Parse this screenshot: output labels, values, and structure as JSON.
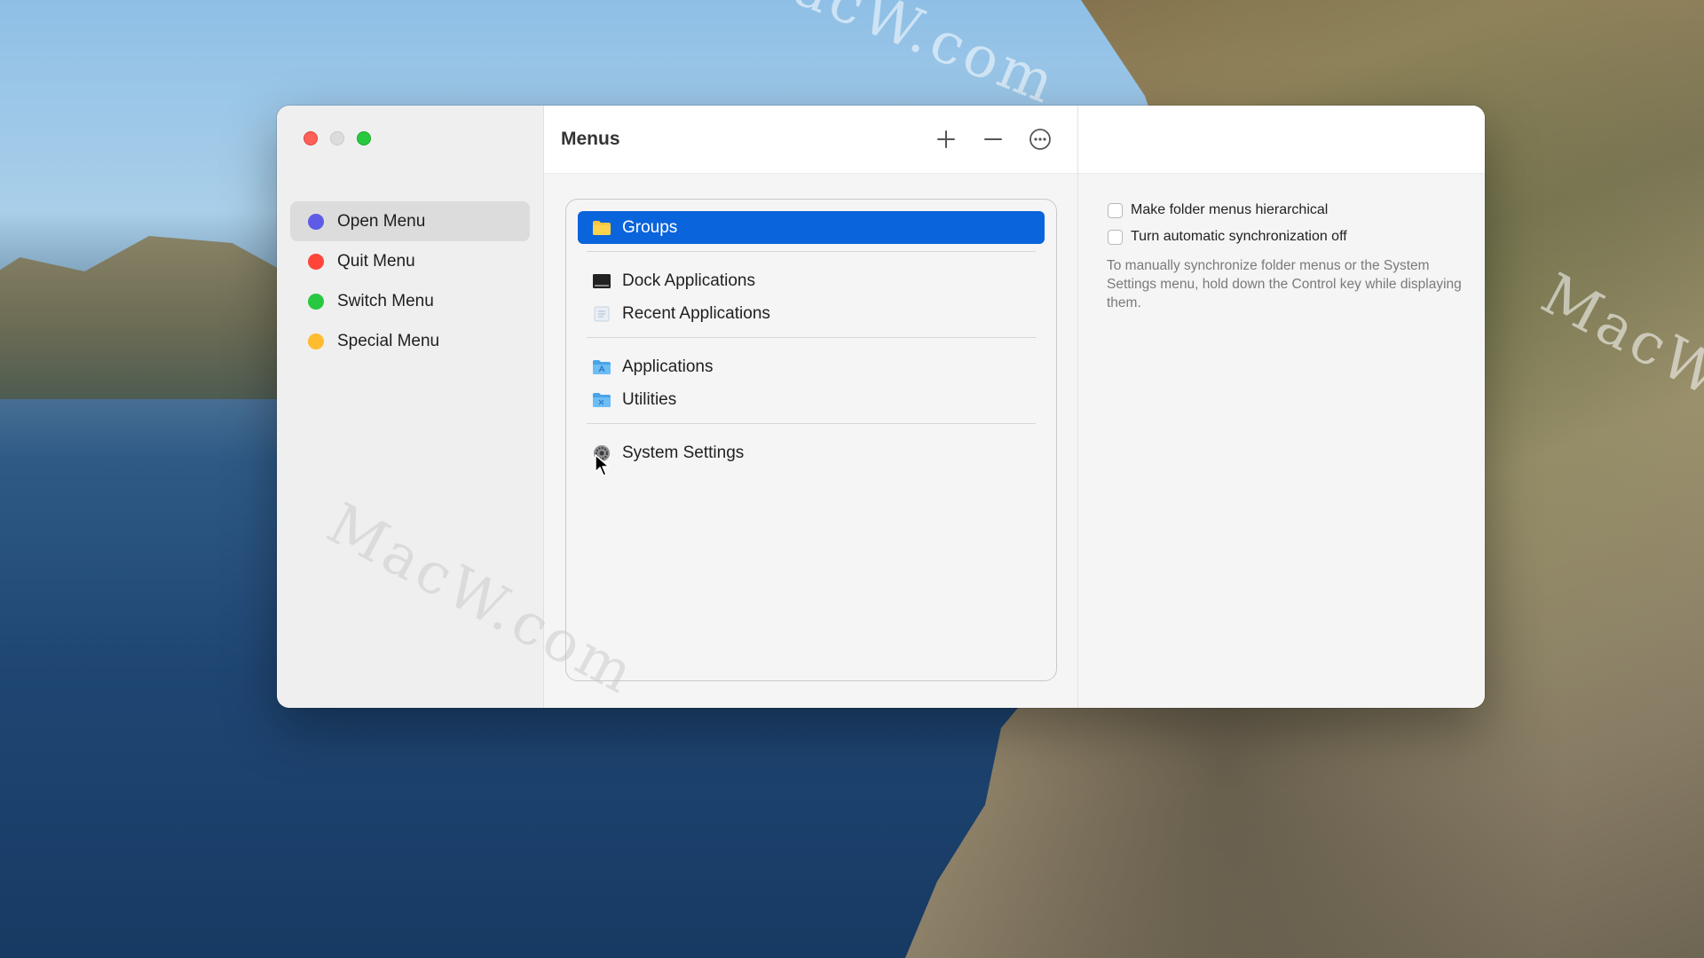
{
  "window": {
    "title": "Menus",
    "toolbar": {
      "add_icon": "plus-icon",
      "remove_icon": "minus-icon",
      "more_icon": "ellipsis-circle-icon"
    }
  },
  "sidebar": {
    "items": [
      {
        "label": "Open Menu",
        "color": "#5e5ce6",
        "active": true
      },
      {
        "label": "Quit Menu",
        "color": "#ff453a",
        "active": false
      },
      {
        "label": "Switch Menu",
        "color": "#28c840",
        "active": false
      },
      {
        "label": "Special Menu",
        "color": "#febc2e",
        "active": false
      }
    ]
  },
  "menu_list": {
    "groups": [
      [
        {
          "label": "Groups",
          "icon": "folder-icon",
          "selected": true
        }
      ],
      [
        {
          "label": "Dock Applications",
          "icon": "dock-icon"
        },
        {
          "label": "Recent Applications",
          "icon": "recent-apps-icon"
        }
      ],
      [
        {
          "label": "Applications",
          "icon": "applications-folder-icon"
        },
        {
          "label": "Utilities",
          "icon": "utilities-folder-icon"
        }
      ],
      [
        {
          "label": "System Settings",
          "icon": "system-settings-icon"
        }
      ]
    ]
  },
  "options": {
    "hierarchical": {
      "label": "Make folder menus hierarchical",
      "checked": false
    },
    "sync_off": {
      "label": "Turn automatic synchronization off",
      "checked": false
    },
    "note": "To manually synchronize folder menus or the System Settings menu, hold down the Control key while displaying them."
  },
  "desktop": {
    "watermark": "MacW.com"
  },
  "colors": {
    "accent": "#0a64dc",
    "sidebar_bg": "#efefef",
    "content_bg": "#f5f5f5"
  }
}
